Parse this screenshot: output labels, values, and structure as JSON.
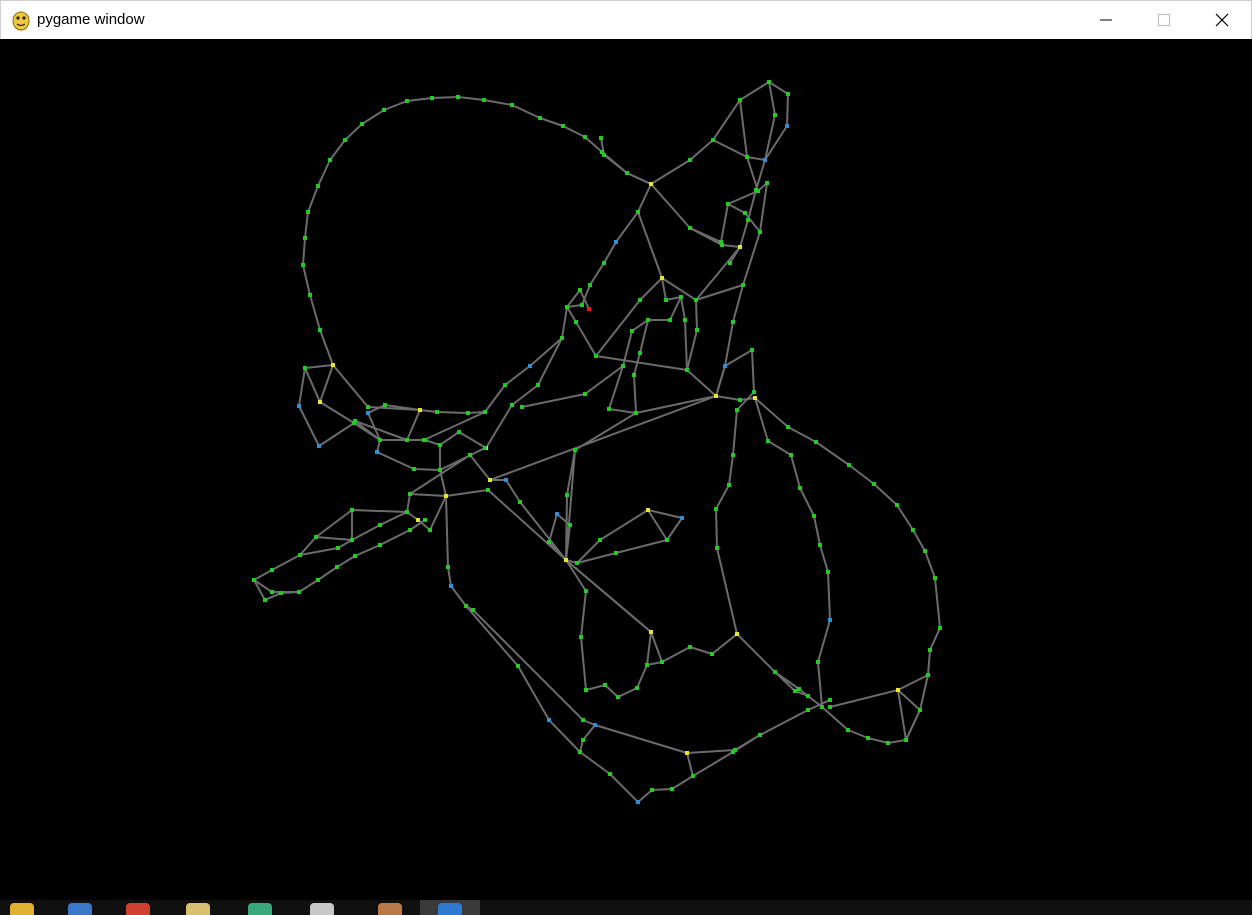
{
  "window": {
    "title": "pygame window",
    "app_icon": "pygame-snake-icon",
    "controls": [
      "minimize-icon",
      "maximize-icon",
      "close-icon"
    ]
  },
  "canvas": {
    "background": "#000000",
    "edge_color": "#6b6b6b",
    "node_colors": {
      "green": "#22cc22",
      "yellow": "#e6e62e",
      "blue": "#2e8ed6",
      "red": "#e01e1e"
    }
  },
  "taskbar": {
    "items": [
      "folder-icon",
      "browser-icon",
      "chrome-icon",
      "files-icon",
      "app-icon",
      "window-icon",
      "tool-icon",
      "pygame-task-icon"
    ]
  }
}
